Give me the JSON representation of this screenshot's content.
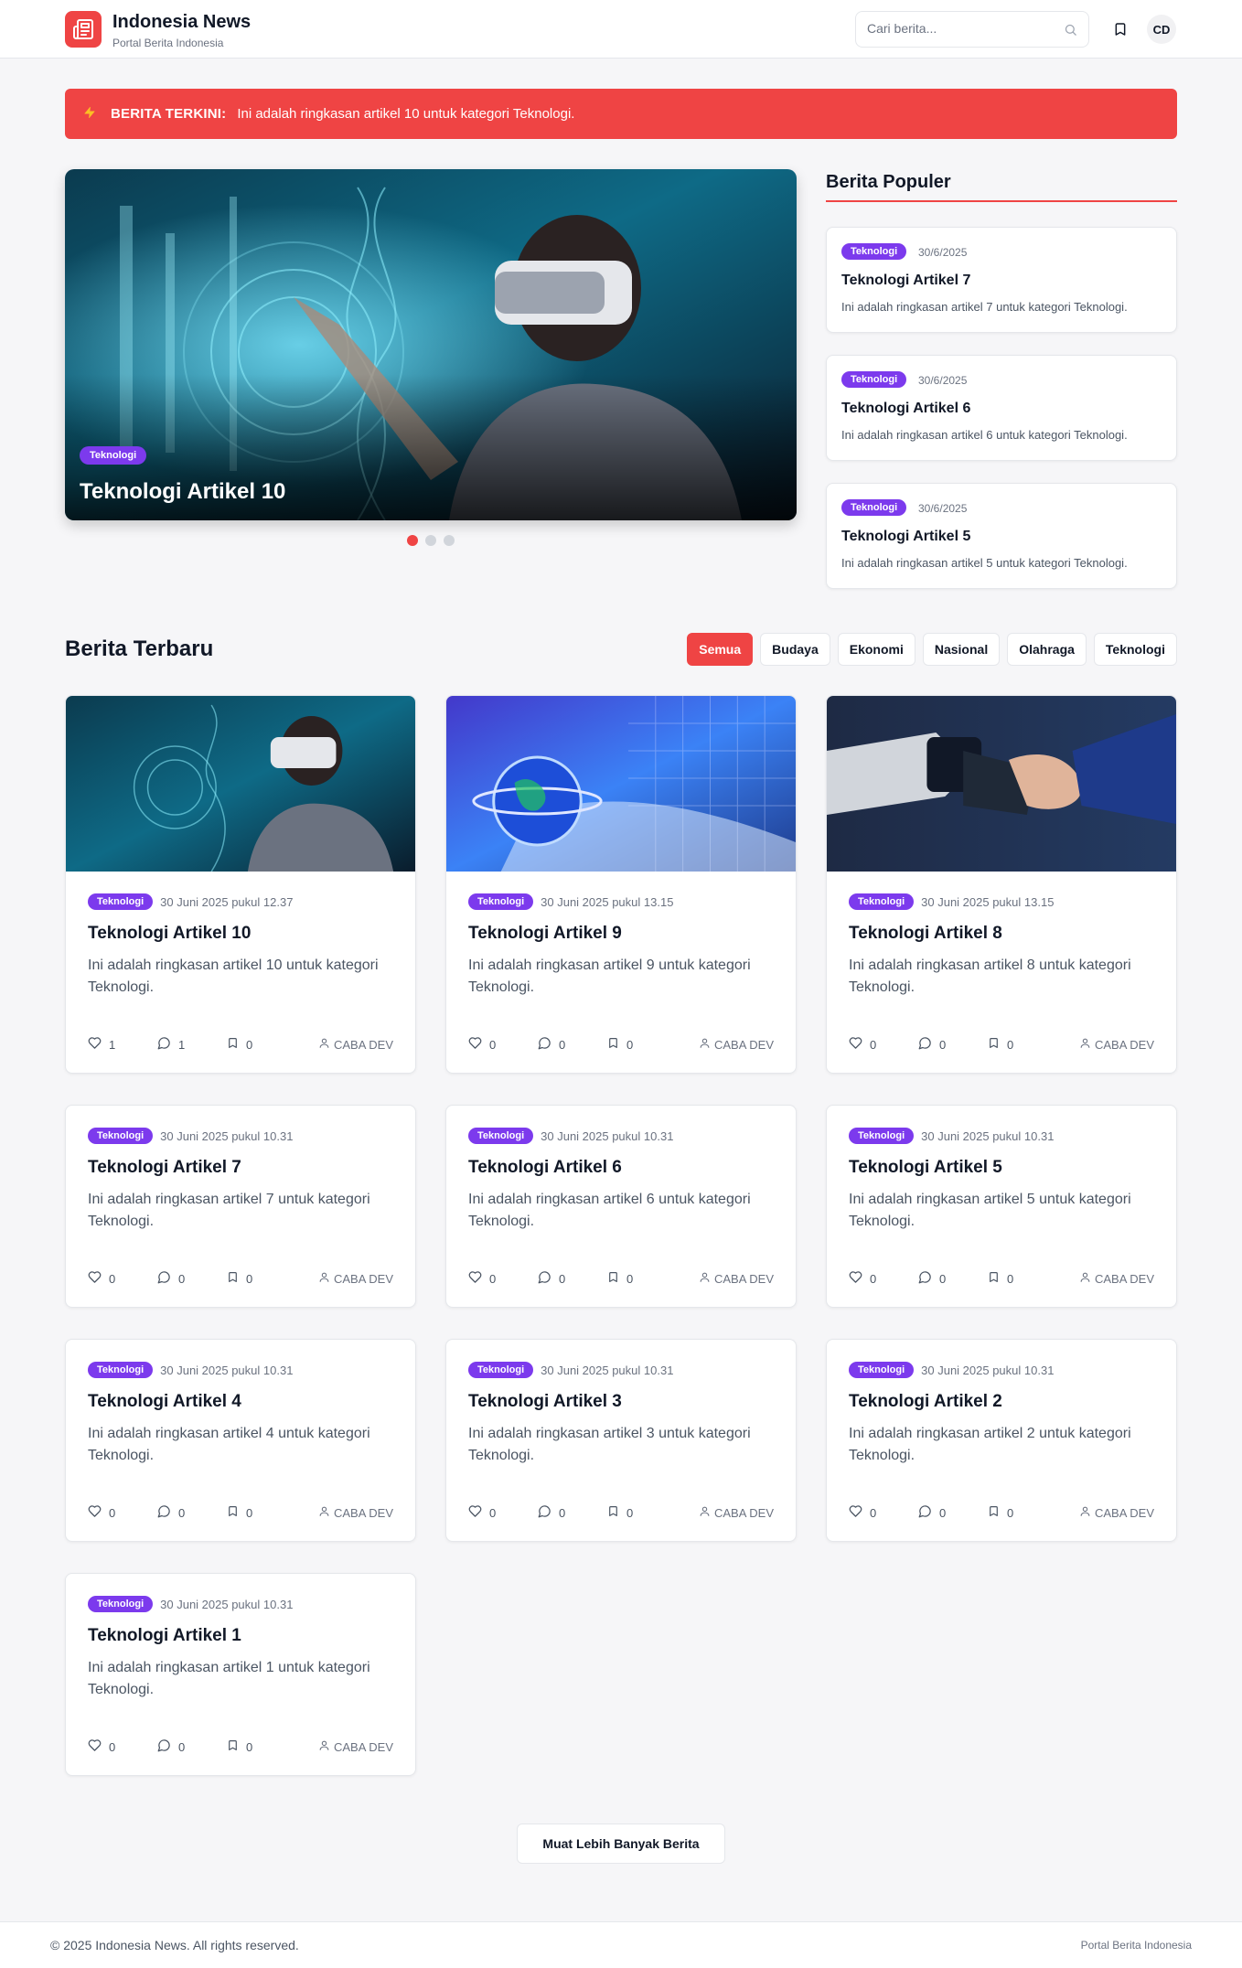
{
  "header": {
    "brand_name": "Indonesia News",
    "brand_tagline": "Portal Berita Indonesia",
    "search_placeholder": "Cari berita...",
    "avatar_initials": "CD"
  },
  "breaking": {
    "label": "BERITA TERKINI:",
    "text": "Ini adalah ringkasan artikel 10 untuk kategori Teknologi."
  },
  "hero": {
    "category": "Teknologi",
    "title": "Teknologi Artikel 10",
    "slide_count": 3,
    "active_slide": 0
  },
  "popular": {
    "title": "Berita Populer",
    "items": [
      {
        "category": "Teknologi",
        "date": "30/6/2025",
        "title": "Teknologi Artikel 7",
        "summary": "Ini adalah ringkasan artikel 7 untuk kategori Teknologi."
      },
      {
        "category": "Teknologi",
        "date": "30/6/2025",
        "title": "Teknologi Artikel 6",
        "summary": "Ini adalah ringkasan artikel 6 untuk kategori Teknologi."
      },
      {
        "category": "Teknologi",
        "date": "30/6/2025",
        "title": "Teknologi Artikel 5",
        "summary": "Ini adalah ringkasan artikel 5 untuk kategori Teknologi."
      }
    ]
  },
  "latest": {
    "title": "Berita Terbaru",
    "filters": [
      "Semua",
      "Budaya",
      "Ekonomi",
      "Nasional",
      "Olahraga",
      "Teknologi"
    ],
    "active_filter": "Semua",
    "articles": [
      {
        "category": "Teknologi",
        "date": "30 Juni 2025 pukul 12.37",
        "title": "Teknologi Artikel 10",
        "summary": "Ini adalah ringkasan artikel 10 untuk kategori Teknologi.",
        "likes": "1",
        "comments": "1",
        "bookmarks": "0",
        "author": "CABA DEV",
        "image": "vr"
      },
      {
        "category": "Teknologi",
        "date": "30 Juni 2025 pukul 13.15",
        "title": "Teknologi Artikel 9",
        "summary": "Ini adalah ringkasan artikel 9 untuk kategori Teknologi.",
        "likes": "0",
        "comments": "0",
        "bookmarks": "0",
        "author": "CABA DEV",
        "image": "globe"
      },
      {
        "category": "Teknologi",
        "date": "30 Juni 2025 pukul 13.15",
        "title": "Teknologi Artikel 8",
        "summary": "Ini adalah ringkasan artikel 8 untuk kategori Teknologi.",
        "likes": "0",
        "comments": "0",
        "bookmarks": "0",
        "author": "CABA DEV",
        "image": "robot"
      },
      {
        "category": "Teknologi",
        "date": "30 Juni 2025 pukul 10.31",
        "title": "Teknologi Artikel 7",
        "summary": "Ini adalah ringkasan artikel 7 untuk kategori Teknologi.",
        "likes": "0",
        "comments": "0",
        "bookmarks": "0",
        "author": "CABA DEV",
        "image": ""
      },
      {
        "category": "Teknologi",
        "date": "30 Juni 2025 pukul 10.31",
        "title": "Teknologi Artikel 6",
        "summary": "Ini adalah ringkasan artikel 6 untuk kategori Teknologi.",
        "likes": "0",
        "comments": "0",
        "bookmarks": "0",
        "author": "CABA DEV",
        "image": ""
      },
      {
        "category": "Teknologi",
        "date": "30 Juni 2025 pukul 10.31",
        "title": "Teknologi Artikel 5",
        "summary": "Ini adalah ringkasan artikel 5 untuk kategori Teknologi.",
        "likes": "0",
        "comments": "0",
        "bookmarks": "0",
        "author": "CABA DEV",
        "image": ""
      },
      {
        "category": "Teknologi",
        "date": "30 Juni 2025 pukul 10.31",
        "title": "Teknologi Artikel 4",
        "summary": "Ini adalah ringkasan artikel 4 untuk kategori Teknologi.",
        "likes": "0",
        "comments": "0",
        "bookmarks": "0",
        "author": "CABA DEV",
        "image": ""
      },
      {
        "category": "Teknologi",
        "date": "30 Juni 2025 pukul 10.31",
        "title": "Teknologi Artikel 3",
        "summary": "Ini adalah ringkasan artikel 3 untuk kategori Teknologi.",
        "likes": "0",
        "comments": "0",
        "bookmarks": "0",
        "author": "CABA DEV",
        "image": ""
      },
      {
        "category": "Teknologi",
        "date": "30 Juni 2025 pukul 10.31",
        "title": "Teknologi Artikel 2",
        "summary": "Ini adalah ringkasan artikel 2 untuk kategori Teknologi.",
        "likes": "0",
        "comments": "0",
        "bookmarks": "0",
        "author": "CABA DEV",
        "image": ""
      },
      {
        "category": "Teknologi",
        "date": "30 Juni 2025 pukul 10.31",
        "title": "Teknologi Artikel 1",
        "summary": "Ini adalah ringkasan artikel 1 untuk kategori Teknologi.",
        "likes": "0",
        "comments": "0",
        "bookmarks": "0",
        "author": "CABA DEV",
        "image": ""
      }
    ],
    "load_more_label": "Muat Lebih Banyak Berita"
  },
  "footer": {
    "copyright": "© 2025 Indonesia News. All rights reserved.",
    "tagline": "Portal Berita Indonesia"
  },
  "colors": {
    "accent": "#ef4444",
    "badge": "#7c3aed"
  }
}
